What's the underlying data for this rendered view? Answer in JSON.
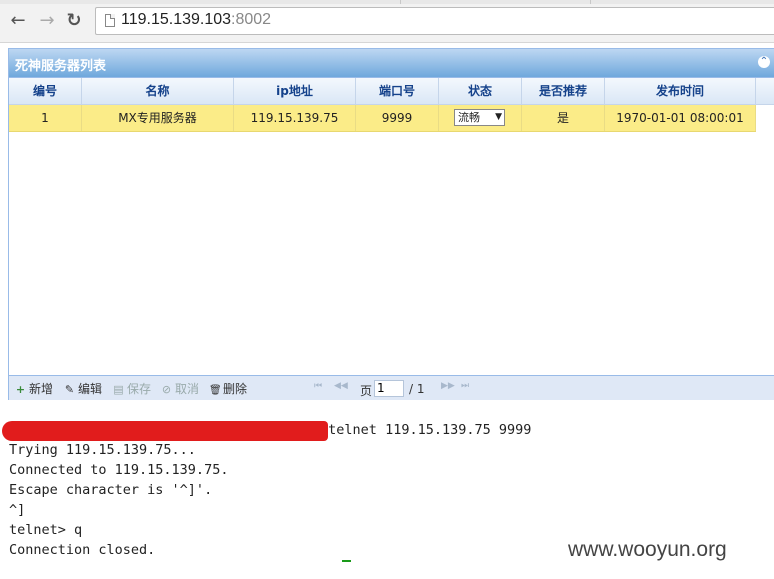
{
  "browser": {
    "back_icon": "←",
    "forward_icon": "→",
    "reload_icon": "↻",
    "url_host": "119.15.139.103",
    "url_port": ":8002"
  },
  "panel": {
    "title": "死神服务器列表",
    "collapse_icon": "⌃"
  },
  "grid": {
    "columns": [
      "编号",
      "名称",
      "ip地址",
      "端口号",
      "状态",
      "是否推荐",
      "发布时间"
    ],
    "rows": [
      {
        "id": "1",
        "name": "MX专用服务器",
        "ip": "119.15.139.75",
        "port": "9999",
        "status": "流畅",
        "recommended": "是",
        "published": "1970-01-01 08:00:01"
      }
    ]
  },
  "toolbar": {
    "add_icon": "+",
    "add_label": "新增",
    "edit_icon": "✎",
    "edit_label": "编辑",
    "save_icon": "▤",
    "save_label": "保存",
    "cancel_icon": "⊘",
    "cancel_label": "取消",
    "delete_icon": "🗑",
    "delete_label": "删除",
    "first_icon": "⏮",
    "prev_icon": "◀◀",
    "page_prefix": "页",
    "page_value": "1",
    "page_total": "/ 1",
    "next_icon": "▶▶",
    "last_icon": "⏭"
  },
  "terminal": {
    "prompt_visible": "/di_fuse_simple$ telnet 119.15.139.75 9999",
    "lines": [
      "Trying 119.15.139.75...",
      "Connected to 119.15.139.75.",
      "Escape character is '^]'.",
      "^]",
      "telnet> q",
      "Connection closed."
    ]
  },
  "watermark": "www.wooyun.org",
  "colors": {
    "row_highlight": "#fbec88",
    "header_text": "#15428b",
    "redaction": "#e11c1c"
  }
}
